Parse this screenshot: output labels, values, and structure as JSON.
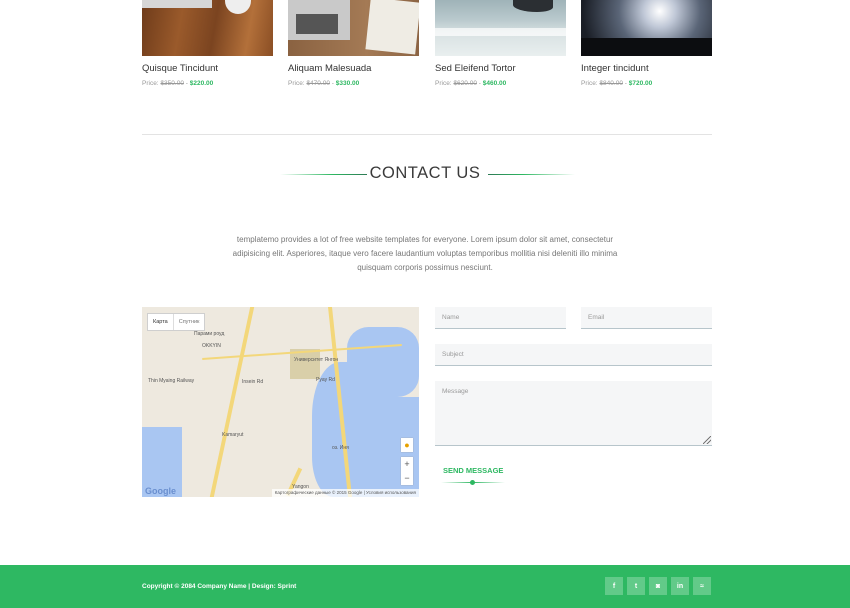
{
  "products": [
    {
      "name": "Quisque Tincidunt",
      "price_label": "Price:",
      "old_price": "$350.00",
      "separator": "-",
      "new_price": "$220.00",
      "image": "wooden-desk-image"
    },
    {
      "name": "Aliquam Malesuada",
      "price_label": "Price:",
      "old_price": "$470.00",
      "separator": "-",
      "new_price": "$330.00",
      "image": "laptop-notebook-image"
    },
    {
      "name": "Sed Eleifend Tortor",
      "price_label": "Price:",
      "old_price": "$620.00",
      "separator": "-",
      "new_price": "$460.00",
      "image": "sea-rock-image"
    },
    {
      "name": "Integer tincidunt",
      "price_label": "Price:",
      "old_price": "$840.00",
      "separator": "-",
      "new_price": "$720.00",
      "image": "concert-crowd-image"
    }
  ],
  "contact": {
    "title": "CONTACT US",
    "intro": "templatemo provides a lot of free website templates for everyone. Lorem ipsum dolor sit amet, consectetur adipisicing elit. Asperiores, itaque vero facere laudantium voluptas temporibus mollitia nisi deleniti illo minima quisquam corporis possimus nesciunt."
  },
  "map": {
    "type_map": "Карта",
    "type_satellite": "Спутник",
    "labels": {
      "road1": "Парами роуд",
      "area1": "OKKYIN",
      "university": "Университет Янгон",
      "station": "Thin Myaing Railway",
      "market": "Kamaryut",
      "lake": "оз. Иня",
      "road2": "Insein Rd",
      "road3": "Pyay Rd",
      "city": "Yangon"
    },
    "logo": "Google",
    "attribution": "Картографические данные © 2015 Google | Условия использования",
    "zoom_in": "+",
    "zoom_out": "−"
  },
  "form": {
    "name_placeholder": "Name",
    "email_placeholder": "Email",
    "subject_placeholder": "Subject",
    "message_placeholder": "Message",
    "send_label": "SEND MESSAGE"
  },
  "footer": {
    "copyright": "Copyright © 2084 Company Name | Design: Sprint",
    "socials": [
      {
        "icon": "facebook-icon",
        "glyph": "f"
      },
      {
        "icon": "twitter-icon",
        "glyph": "t"
      },
      {
        "icon": "instagram-icon",
        "glyph": "◙"
      },
      {
        "icon": "linkedin-icon",
        "glyph": "in"
      },
      {
        "icon": "rss-icon",
        "glyph": "≈"
      }
    ]
  },
  "colors": {
    "accent": "#2eb862",
    "footer_bg": "#2eb862",
    "input_bg": "#f5f6f7",
    "map_water": "#a9c6f2"
  }
}
